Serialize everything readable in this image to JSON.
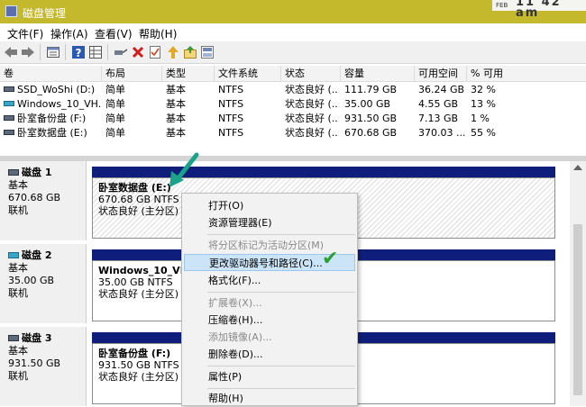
{
  "window": {
    "title": "磁盘管理",
    "clock_day": "FEB",
    "clock_time": "11 42 am"
  },
  "menu": [
    "文件(F)",
    "操作(A)",
    "查看(V)",
    "帮助(H)"
  ],
  "toolbar_icons": [
    "back-arrow-icon",
    "forward-arrow-icon",
    "properties-icon",
    "help-icon",
    "properties-grid-icon",
    "connect-icon",
    "delete-icon",
    "check-icon",
    "up-icon",
    "import-icon",
    "refresh-icon"
  ],
  "volume_table": {
    "headers": [
      "卷",
      "布局",
      "类型",
      "文件系统",
      "状态",
      "容量",
      "可用空间",
      "% 可用"
    ],
    "rows": [
      {
        "volume": "SSD_WoShi (D:)",
        "layout": "简单",
        "type": "基本",
        "fs": "NTFS",
        "status": "状态良好 (...",
        "capacity": "111.79 GB",
        "free": "36.24 GB",
        "pct": "32 %",
        "icon": "drive"
      },
      {
        "volume": "Windows_10_VH...",
        "layout": "简单",
        "type": "基本",
        "fs": "NTFS",
        "status": "状态良好 (...",
        "capacity": "35.00 GB",
        "free": "4.55 GB",
        "pct": "13 %",
        "icon": "vhd"
      },
      {
        "volume": "卧室备份盘 (F:)",
        "layout": "简单",
        "type": "基本",
        "fs": "NTFS",
        "status": "状态良好 (...",
        "capacity": "931.50 GB",
        "free": "7.13 GB",
        "pct": "1 %",
        "icon": "drive"
      },
      {
        "volume": "卧室数据盘 (E:)",
        "layout": "简单",
        "type": "基本",
        "fs": "NTFS",
        "status": "状态良好 (...",
        "capacity": "670.68 GB",
        "free": "370.03 ...",
        "pct": "55 %",
        "icon": "drive"
      }
    ]
  },
  "disks": [
    {
      "name": "磁盘 1",
      "type": "基本",
      "size": "670.68 GB",
      "state": "联机",
      "icon": "drive",
      "partition": {
        "name": "卧室数据盘 (E:)",
        "size": "670.68 GB NTFS",
        "status": "状态良好 (主分区)"
      }
    },
    {
      "name": "磁盘 2",
      "type": "基本",
      "size": "35.00 GB",
      "state": "联机",
      "icon": "vhd",
      "partition": {
        "name": "Windows_10_VHD",
        "size": "35.00 GB NTFS",
        "status": "状态良好 (主分区)"
      }
    },
    {
      "name": "磁盘 3",
      "type": "基本",
      "size": "931.50 GB",
      "state": "联机",
      "icon": "drive",
      "partition": {
        "name": "卧室备份盘 (F:)",
        "size": "931.50 GB NTFS",
        "status": "状态良好 (主分区)"
      }
    }
  ],
  "context_menu": {
    "items": [
      {
        "label": "打开(O)",
        "enabled": true
      },
      {
        "label": "资源管理器(E)",
        "enabled": true
      },
      {
        "label": "将分区标记为活动分区(M)",
        "enabled": false
      },
      {
        "label": "更改驱动器号和路径(C)...",
        "enabled": true,
        "highlighted": true
      },
      {
        "label": "格式化(F)...",
        "enabled": true
      },
      {
        "label": "扩展卷(X)...",
        "enabled": false
      },
      {
        "label": "压缩卷(H)...",
        "enabled": true
      },
      {
        "label": "添加镜像(A)...",
        "enabled": false
      },
      {
        "label": "删除卷(D)...",
        "enabled": true
      },
      {
        "label": "属性(P)",
        "enabled": true
      },
      {
        "label": "帮助(H)",
        "enabled": true
      }
    ]
  },
  "colors": {
    "title_bar": "#c4b92c",
    "partition_bar": "#0f1e7a",
    "menu_highlight": "#cce4f7",
    "annotation": "#1aa38a",
    "check": "#2c9e36"
  }
}
